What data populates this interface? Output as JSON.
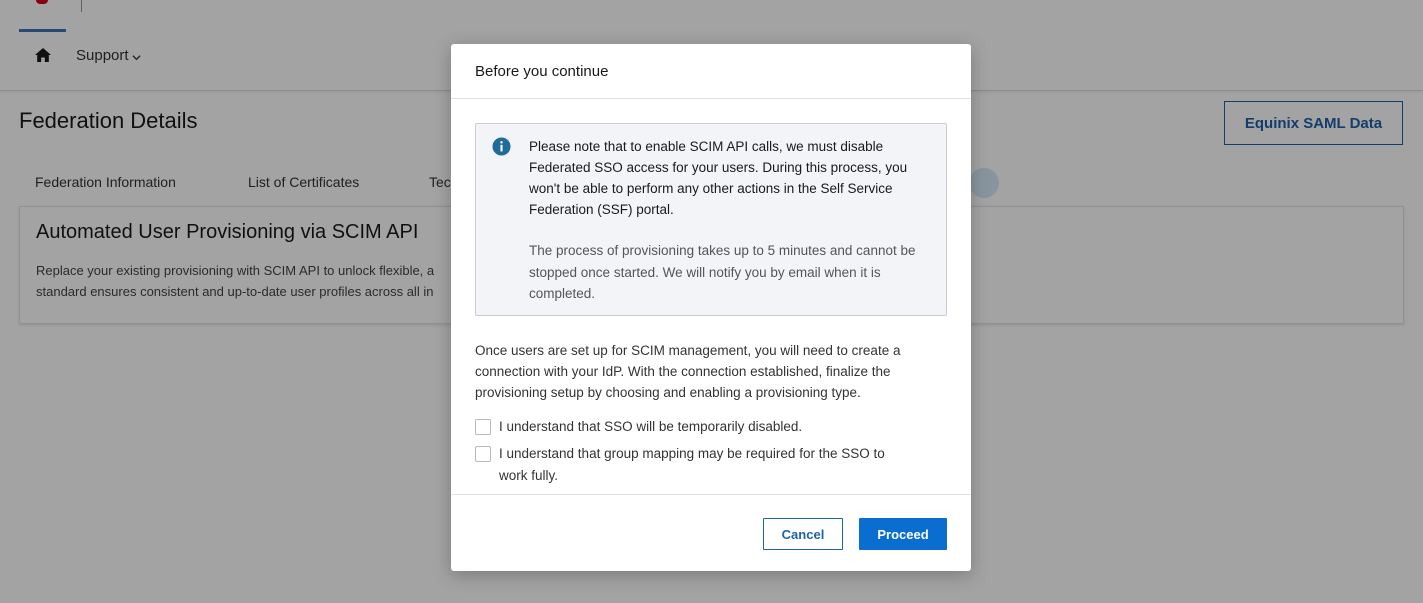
{
  "nav": {
    "support_label": "Support"
  },
  "page": {
    "title": "Federation Details",
    "saml_button": "Equinix SAML Data"
  },
  "tabs": [
    {
      "label": "Federation Information"
    },
    {
      "label": "List of Certificates"
    },
    {
      "label": "Tec"
    }
  ],
  "card": {
    "title": "Automated User Provisioning via SCIM API",
    "desc_line1": "Replace your existing provisioning with SCIM API to unlock flexible, a",
    "desc_line2": "standard ensures consistent and up-to-date user profiles across all in"
  },
  "modal": {
    "title": "Before you continue",
    "notice_primary": "Please note that to enable SCIM API calls, we must disable Federated SSO access for your users. During this process, you won't be able to perform any other actions in the Self Service Federation (SSF) portal.",
    "notice_secondary": "The process of provisioning takes up to 5 minutes and cannot be stopped once started. We will notify you by email when it is completed.",
    "body": "Once users are set up for SCIM management, you will need to create a connection with your IdP. With the connection established, finalize the provisioning setup by choosing and enabling a provisioning type.",
    "checkbox1": "I understand that SSO will be temporarily disabled.",
    "checkbox2": "I understand that group mapping may be required for the SSO to work fully.",
    "cancel_label": "Cancel",
    "proceed_label": "Proceed"
  },
  "colors": {
    "accent": "#0a6ed1",
    "link_blue": "#1e62a8",
    "info_icon": "#1f6b9a",
    "overlay": "rgba(0,0,0,0.36)"
  },
  "icons": {
    "home": "home-icon",
    "support_chevron": "chevron-down-icon",
    "notice": "info-icon"
  }
}
